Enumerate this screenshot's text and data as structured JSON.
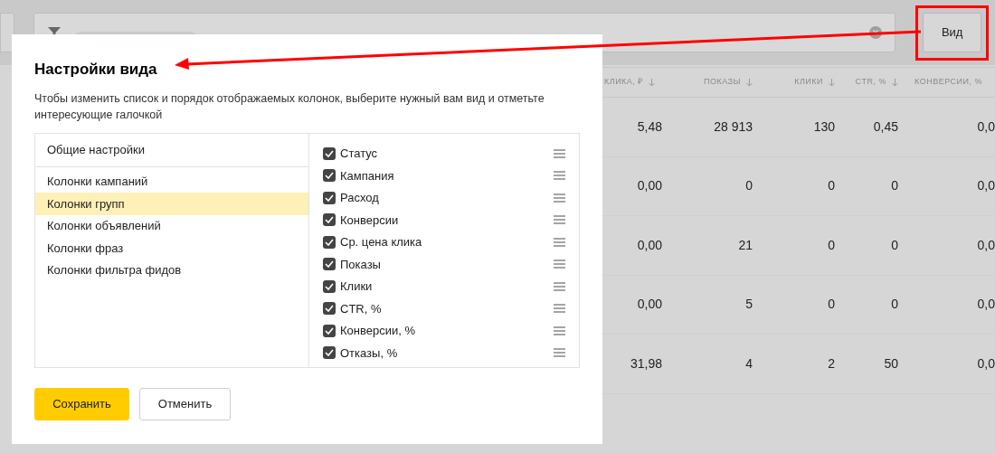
{
  "toolbar": {
    "view_button": "Вид"
  },
  "table": {
    "columns": [
      "КЛИКА, ₽",
      "ПОКАЗЫ",
      "КЛИКИ",
      "CTR, %",
      "КОНВЕРСИИ, %"
    ],
    "rows": [
      [
        "5,48",
        "28 913",
        "130",
        "0,45",
        "0,0"
      ],
      [
        "0,00",
        "0",
        "0",
        "0",
        "0,0"
      ],
      [
        "0,00",
        "21",
        "0",
        "0",
        "0,0"
      ],
      [
        "0,00",
        "5",
        "0",
        "0",
        "0,0"
      ],
      [
        "31,98",
        "4",
        "2",
        "50",
        "0,0"
      ]
    ]
  },
  "dialog": {
    "title": "Настройки вида",
    "description": "Чтобы изменить список и порядок отображаемых колонок, выберите нужный вам вид и отметьте интересующие галочкой",
    "general": "Общие настройки",
    "views": [
      {
        "label": "Колонки кампаний",
        "selected": false
      },
      {
        "label": "Колонки групп",
        "selected": true
      },
      {
        "label": "Колонки объявлений",
        "selected": false
      },
      {
        "label": "Колонки фраз",
        "selected": false
      },
      {
        "label": "Колонки фильтра фидов",
        "selected": false
      }
    ],
    "columns": [
      {
        "label": "Статус",
        "checked": true
      },
      {
        "label": "Кампания",
        "checked": true
      },
      {
        "label": "Расход",
        "checked": true
      },
      {
        "label": "Конверсии",
        "checked": true
      },
      {
        "label": "Ср. цена клика",
        "checked": true
      },
      {
        "label": "Показы",
        "checked": true
      },
      {
        "label": "Клики",
        "checked": true
      },
      {
        "label": "CTR, %",
        "checked": true
      },
      {
        "label": "Конверсии, %",
        "checked": true
      },
      {
        "label": "Отказы, %",
        "checked": true
      }
    ],
    "buttons": [
      {
        "kind": "primary",
        "label": "Сохранить"
      },
      {
        "kind": "secondary",
        "label": "Отменить"
      }
    ]
  }
}
